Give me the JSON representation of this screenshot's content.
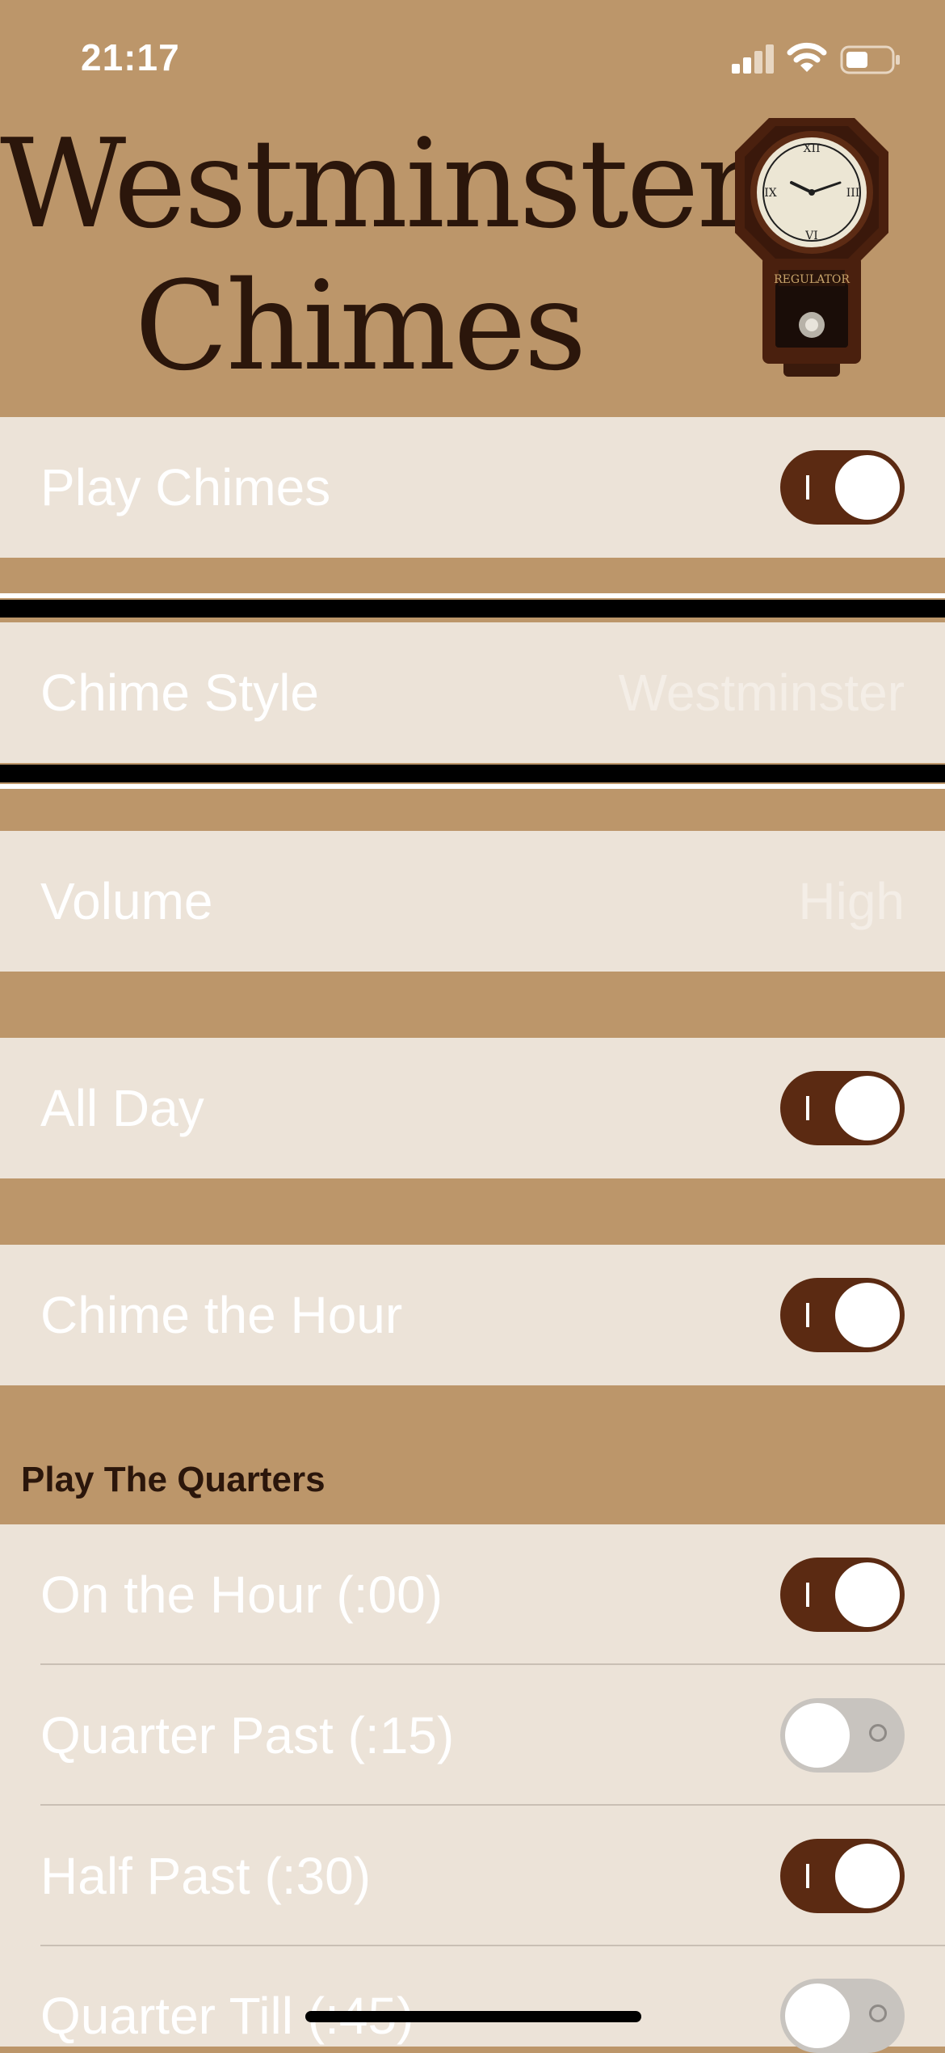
{
  "status_bar": {
    "time": "21:17"
  },
  "header": {
    "title_line1": "Westminster",
    "title_line2": "Chimes",
    "clock_image": "regulator-wall-clock"
  },
  "settings": {
    "play_chimes": {
      "label": "Play Chimes",
      "on": true
    },
    "chime_style": {
      "label": "Chime Style",
      "value": "Westminster"
    },
    "volume": {
      "label": "Volume",
      "value": "High"
    },
    "all_day": {
      "label": "All Day",
      "on": true
    },
    "chime_hour": {
      "label": "Chime the Hour",
      "on": true
    }
  },
  "quarters": {
    "header": "Play The Quarters",
    "items": [
      {
        "label": "On the Hour (:00)",
        "on": true
      },
      {
        "label": "Quarter Past (:15)",
        "on": false
      },
      {
        "label": "Half Past (:30)",
        "on": true
      },
      {
        "label": "Quarter Till (:45)",
        "on": false
      }
    ]
  },
  "colors": {
    "background": "#bc966a",
    "row": "#ece3d8",
    "toggle_on": "#5b2a12",
    "title": "#2b160b"
  }
}
